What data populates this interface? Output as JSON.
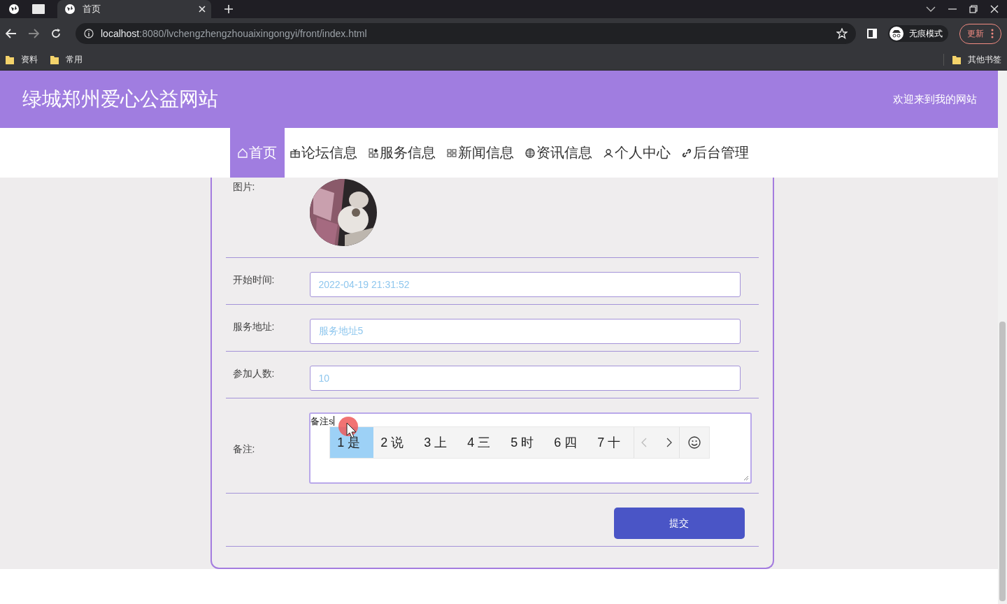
{
  "browser": {
    "tabs": [
      {
        "title": "首页",
        "selected": true
      }
    ],
    "address": {
      "host": "localhost",
      "rest": ":8080/lvchengzhengzhouaixingongyi/front/index.html"
    },
    "profile": "无痕模式",
    "update": "更新",
    "bookmarks": [
      "资料",
      "常用"
    ],
    "other_bookmarks": "其他书签"
  },
  "header": {
    "title": "绿城郑州爱心公益网站",
    "welcome": "欢迎来到我的网站"
  },
  "nav": [
    {
      "label": "首页",
      "selected": true
    },
    {
      "label": "论坛信息",
      "selected": false
    },
    {
      "label": "服务信息",
      "selected": false
    },
    {
      "label": "新闻信息",
      "selected": false
    },
    {
      "label": "资讯信息",
      "selected": false
    },
    {
      "label": "个人中心",
      "selected": false
    },
    {
      "label": "后台管理",
      "selected": false
    }
  ],
  "form": {
    "image_label": "图片:",
    "fields": [
      {
        "label": "开始时间:",
        "value": "2022-04-19 21:31:52"
      },
      {
        "label": "服务地址:",
        "value": "服务地址5"
      },
      {
        "label": "参加人数:",
        "value": "10"
      }
    ],
    "remark": {
      "label": "备注:",
      "value": "备注s",
      "candidates": [
        {
          "text": "1 是",
          "selected": true
        },
        {
          "text": "2 说",
          "selected": false
        },
        {
          "text": "3 上",
          "selected": false
        },
        {
          "text": "4 三",
          "selected": false
        },
        {
          "text": "5 时",
          "selected": false
        },
        {
          "text": "6 四",
          "selected": false
        },
        {
          "text": "7 十",
          "selected": false
        }
      ]
    },
    "submit": "提交"
  }
}
